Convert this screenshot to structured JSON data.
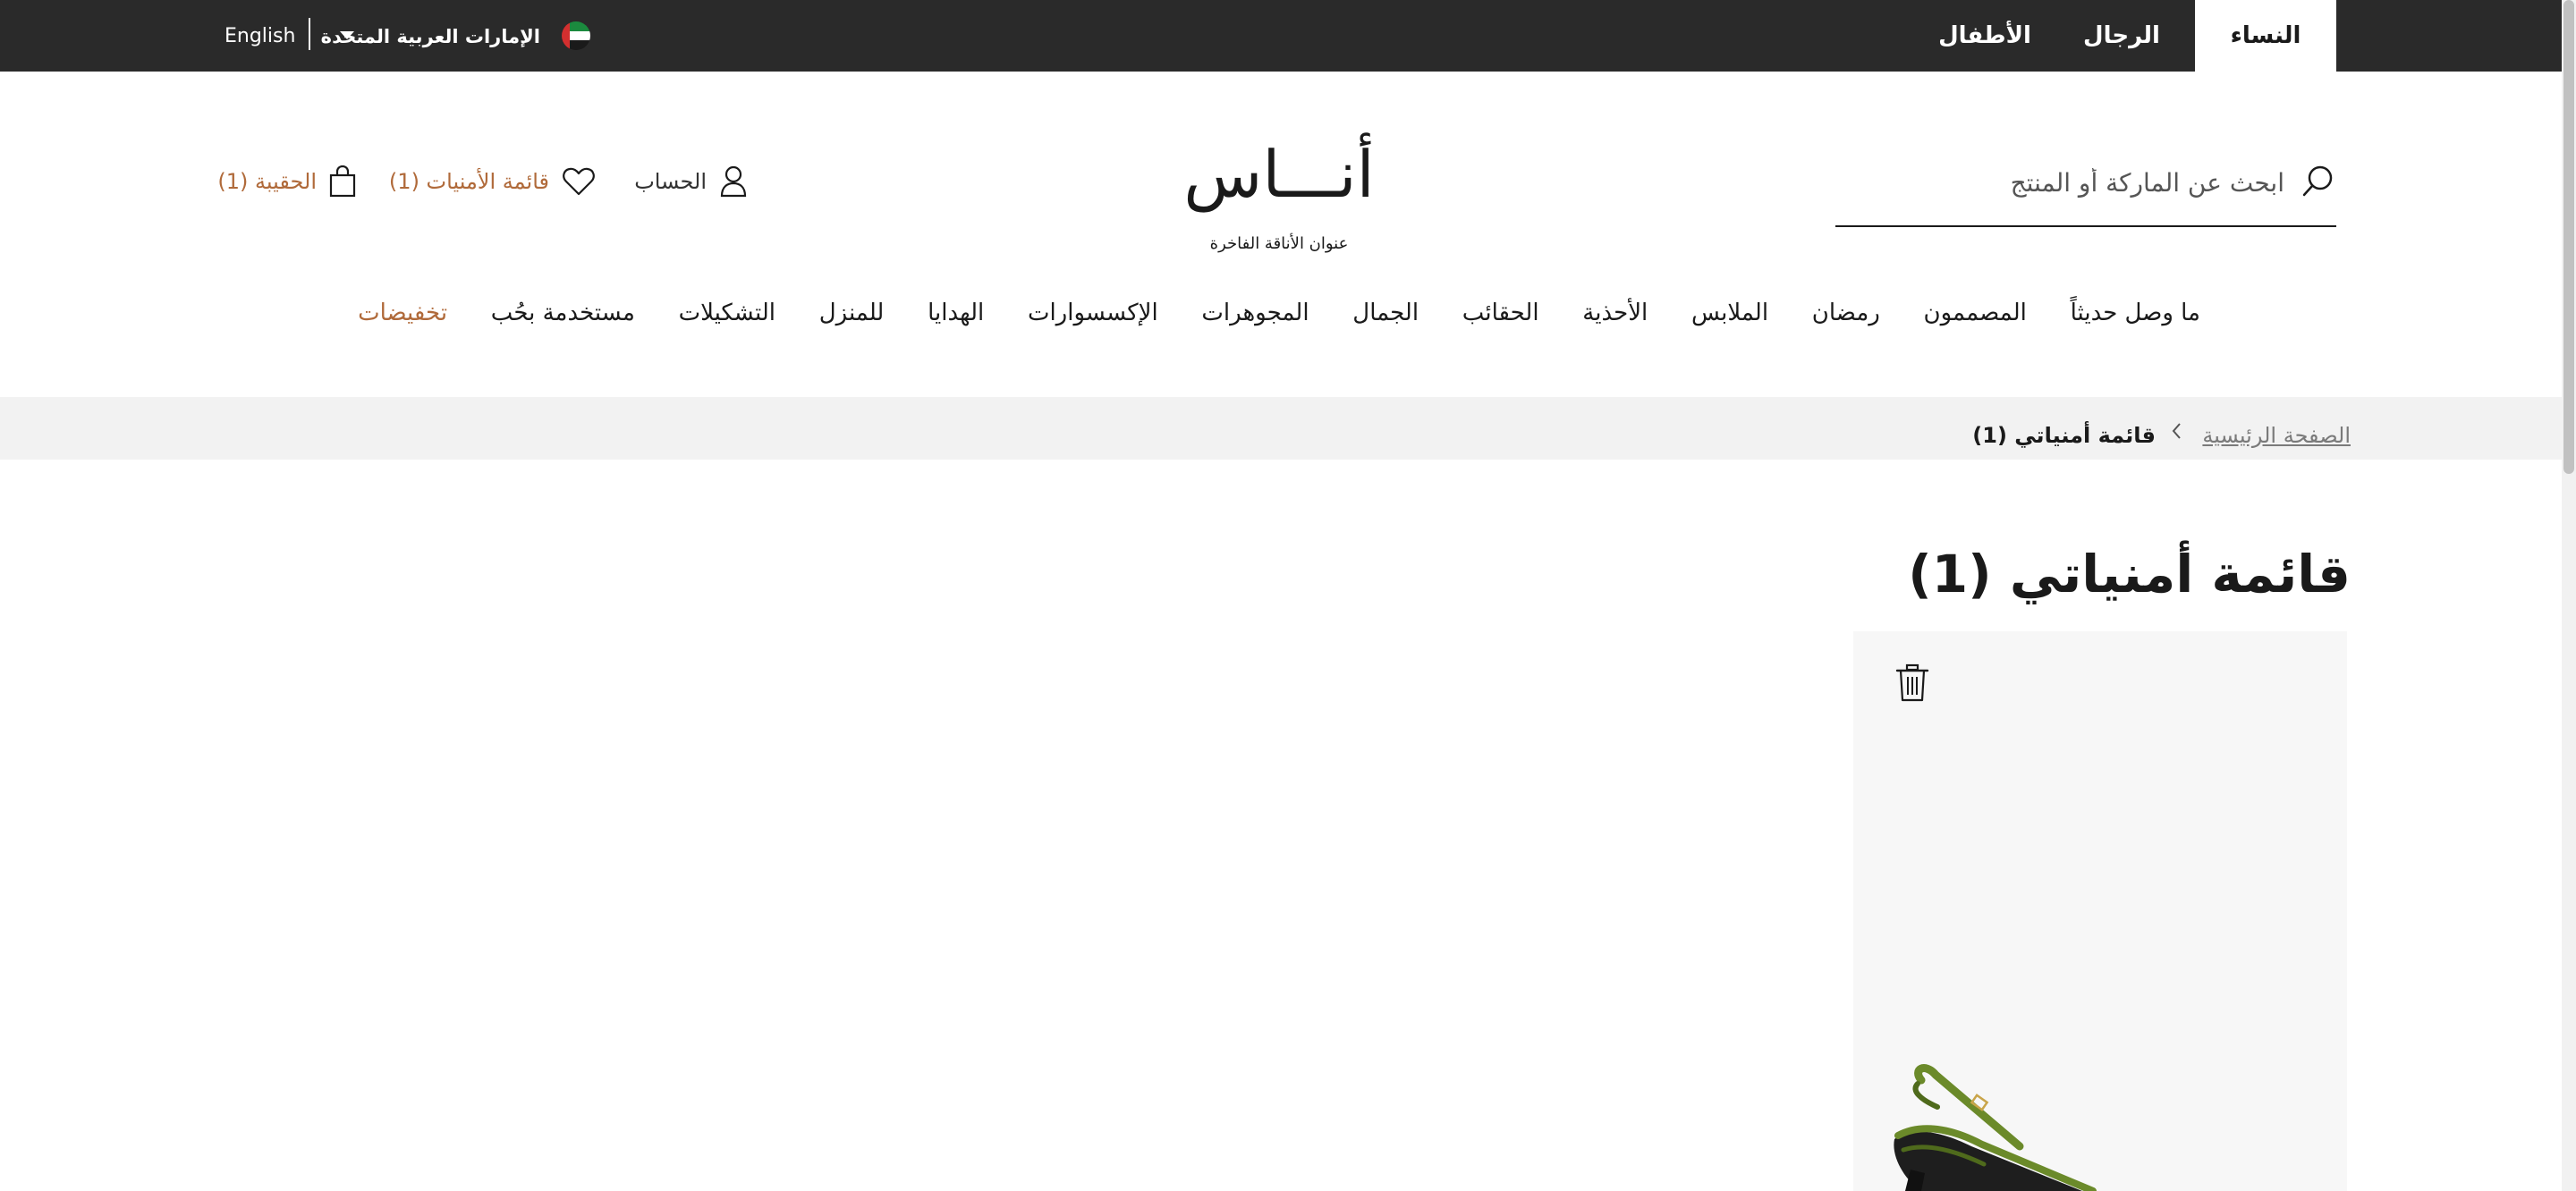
{
  "topbar": {
    "tabs": [
      {
        "label": "النساء",
        "active": true
      },
      {
        "label": "الرجال",
        "active": false
      },
      {
        "label": "الأطفال",
        "active": false
      }
    ],
    "country": "الإمارات العربية المتحدة",
    "language": "English",
    "flag_icon": "uae-flag-icon"
  },
  "header": {
    "search_placeholder": "ابحث عن الماركة أو المنتج",
    "logo": "أنـــاس",
    "tagline": "عنوان الأناقة الفاخرة",
    "account_label": "الحساب",
    "wishlist_label": "قائمة الأمنيات (1)",
    "bag_label": "الحقيبة (1)"
  },
  "nav": {
    "items": [
      {
        "label": "ما وصل حديثاً"
      },
      {
        "label": "المصممون"
      },
      {
        "label": "رمضان"
      },
      {
        "label": "الملابس"
      },
      {
        "label": "الأحذية"
      },
      {
        "label": "الحقائب"
      },
      {
        "label": "الجمال"
      },
      {
        "label": "المجوهرات"
      },
      {
        "label": "الإكسسوارات"
      },
      {
        "label": "الهدايا"
      },
      {
        "label": "للمنزل"
      },
      {
        "label": "التشكيلات"
      },
      {
        "label": "مستخدمة بحُب"
      },
      {
        "label": "تخفيضات"
      }
    ]
  },
  "breadcrumb": {
    "home": "الصفحة الرئيسية",
    "current": "قائمة أمنياتي (1)"
  },
  "page": {
    "title": "قائمة أمنياتي (1)"
  },
  "colors": {
    "topbar_bg": "#2a2a2a",
    "accent": "#b06a3a",
    "breadcrumb_bg": "#f2f2f2",
    "card_bg": "#f7f7f7"
  }
}
